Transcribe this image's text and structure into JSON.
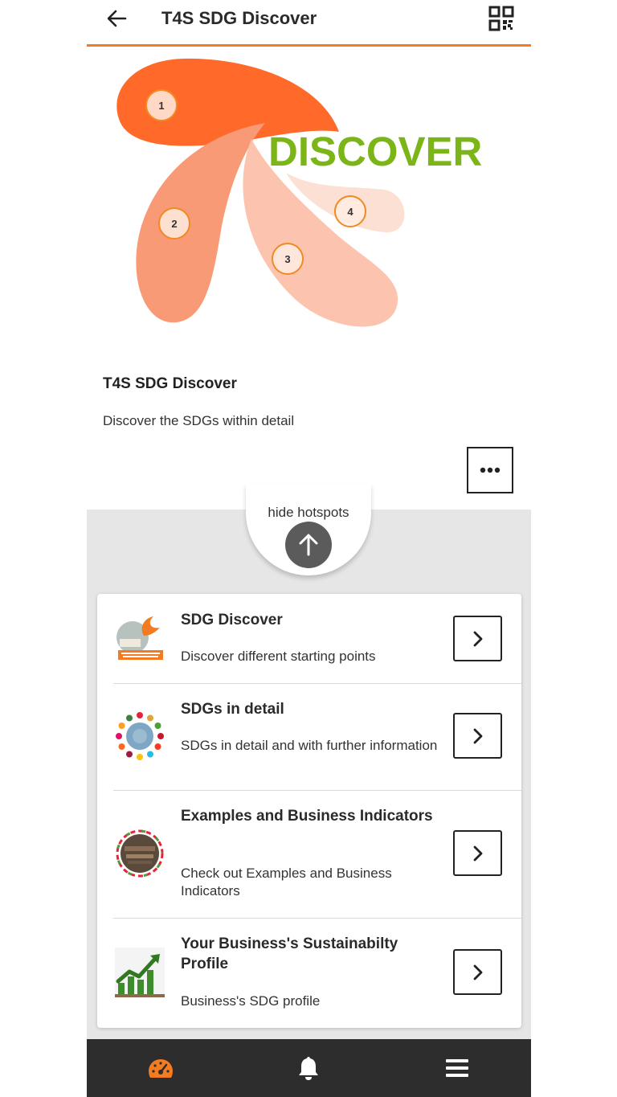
{
  "header": {
    "title": "T4S SDG Discover",
    "back_icon": "back-arrow-icon",
    "qr_icon": "qr-code-icon"
  },
  "hero": {
    "wordmark": "DISCOVER",
    "hotspots": [
      "1",
      "2",
      "3",
      "4"
    ],
    "colors": {
      "petal_dark": "#ff6a2b",
      "petal_mid": "#f99a76",
      "petal_light": "#fcc4ae",
      "petal_pale": "#fde0d4",
      "wordmark": "#7cb518"
    }
  },
  "info": {
    "title": "T4S SDG Discover",
    "description": "Discover the SDGs within detail",
    "more_icon": "more-dots-icon"
  },
  "hotspot_toggle": {
    "label": "hide hotspots",
    "icon": "arrow-up-icon"
  },
  "list": {
    "items": [
      {
        "title": "SDG Discover",
        "description": "Discover different starting points",
        "icon": "sdg-discover-thumbnail"
      },
      {
        "title": "SDGs in detail",
        "description": "SDGs in detail and with further information",
        "icon": "sdg-wheel-thumbnail"
      },
      {
        "title": "Examples and Business Indicators",
        "description": "Check out Examples and Business Indicators",
        "icon": "examples-thumbnail"
      },
      {
        "title": "Your Business's Sustainabilty Profile",
        "description": "Business's SDG profile",
        "icon": "growth-chart-thumbnail"
      }
    ]
  },
  "bottom_nav": {
    "items": [
      "dashboard-icon",
      "notifications-bell-icon",
      "menu-hamburger-icon"
    ],
    "active_color": "#f37b21",
    "color": "#ffffff"
  },
  "accent": "#f37b21"
}
